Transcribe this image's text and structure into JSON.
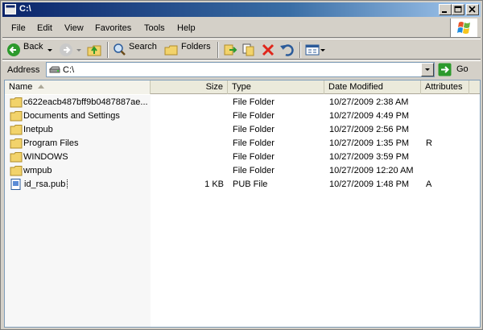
{
  "window": {
    "title": "C:\\"
  },
  "menu": [
    "File",
    "Edit",
    "View",
    "Favorites",
    "Tools",
    "Help"
  ],
  "toolbar": {
    "back_label": "Back",
    "search_label": "Search",
    "folders_label": "Folders"
  },
  "address": {
    "label": "Address",
    "value": "C:\\",
    "go_label": "Go"
  },
  "columns": {
    "name": "Name",
    "size": "Size",
    "type": "Type",
    "date": "Date Modified",
    "attributes": "Attributes"
  },
  "files": [
    {
      "name": "c622eacb487bff9b0487887ae...",
      "size": "",
      "type": "File Folder",
      "date": "10/27/2009 2:38 AM",
      "attributes": "",
      "icon": "folder-icon"
    },
    {
      "name": "Documents and Settings",
      "size": "",
      "type": "File Folder",
      "date": "10/27/2009 4:49 PM",
      "attributes": "",
      "icon": "folder-icon"
    },
    {
      "name": "Inetpub",
      "size": "",
      "type": "File Folder",
      "date": "10/27/2009 2:56 PM",
      "attributes": "",
      "icon": "folder-icon"
    },
    {
      "name": "Program Files",
      "size": "",
      "type": "File Folder",
      "date": "10/27/2009 1:35 PM",
      "attributes": "R",
      "icon": "folder-icon"
    },
    {
      "name": "WINDOWS",
      "size": "",
      "type": "File Folder",
      "date": "10/27/2009 3:59 PM",
      "attributes": "",
      "icon": "folder-icon"
    },
    {
      "name": "wmpub",
      "size": "",
      "type": "File Folder",
      "date": "10/27/2009 12:20 AM",
      "attributes": "",
      "icon": "folder-icon"
    },
    {
      "name": "id_rsa.pub",
      "size": "1 KB",
      "type": "PUB File",
      "date": "10/27/2009 1:48 PM",
      "attributes": "A",
      "icon": "pub-file-icon",
      "selected": true
    }
  ],
  "colors": {
    "title_bar": "#0a246a",
    "face": "#d4d0c8",
    "folder": "#f2d36b",
    "go_green": "#2c9a2c"
  }
}
